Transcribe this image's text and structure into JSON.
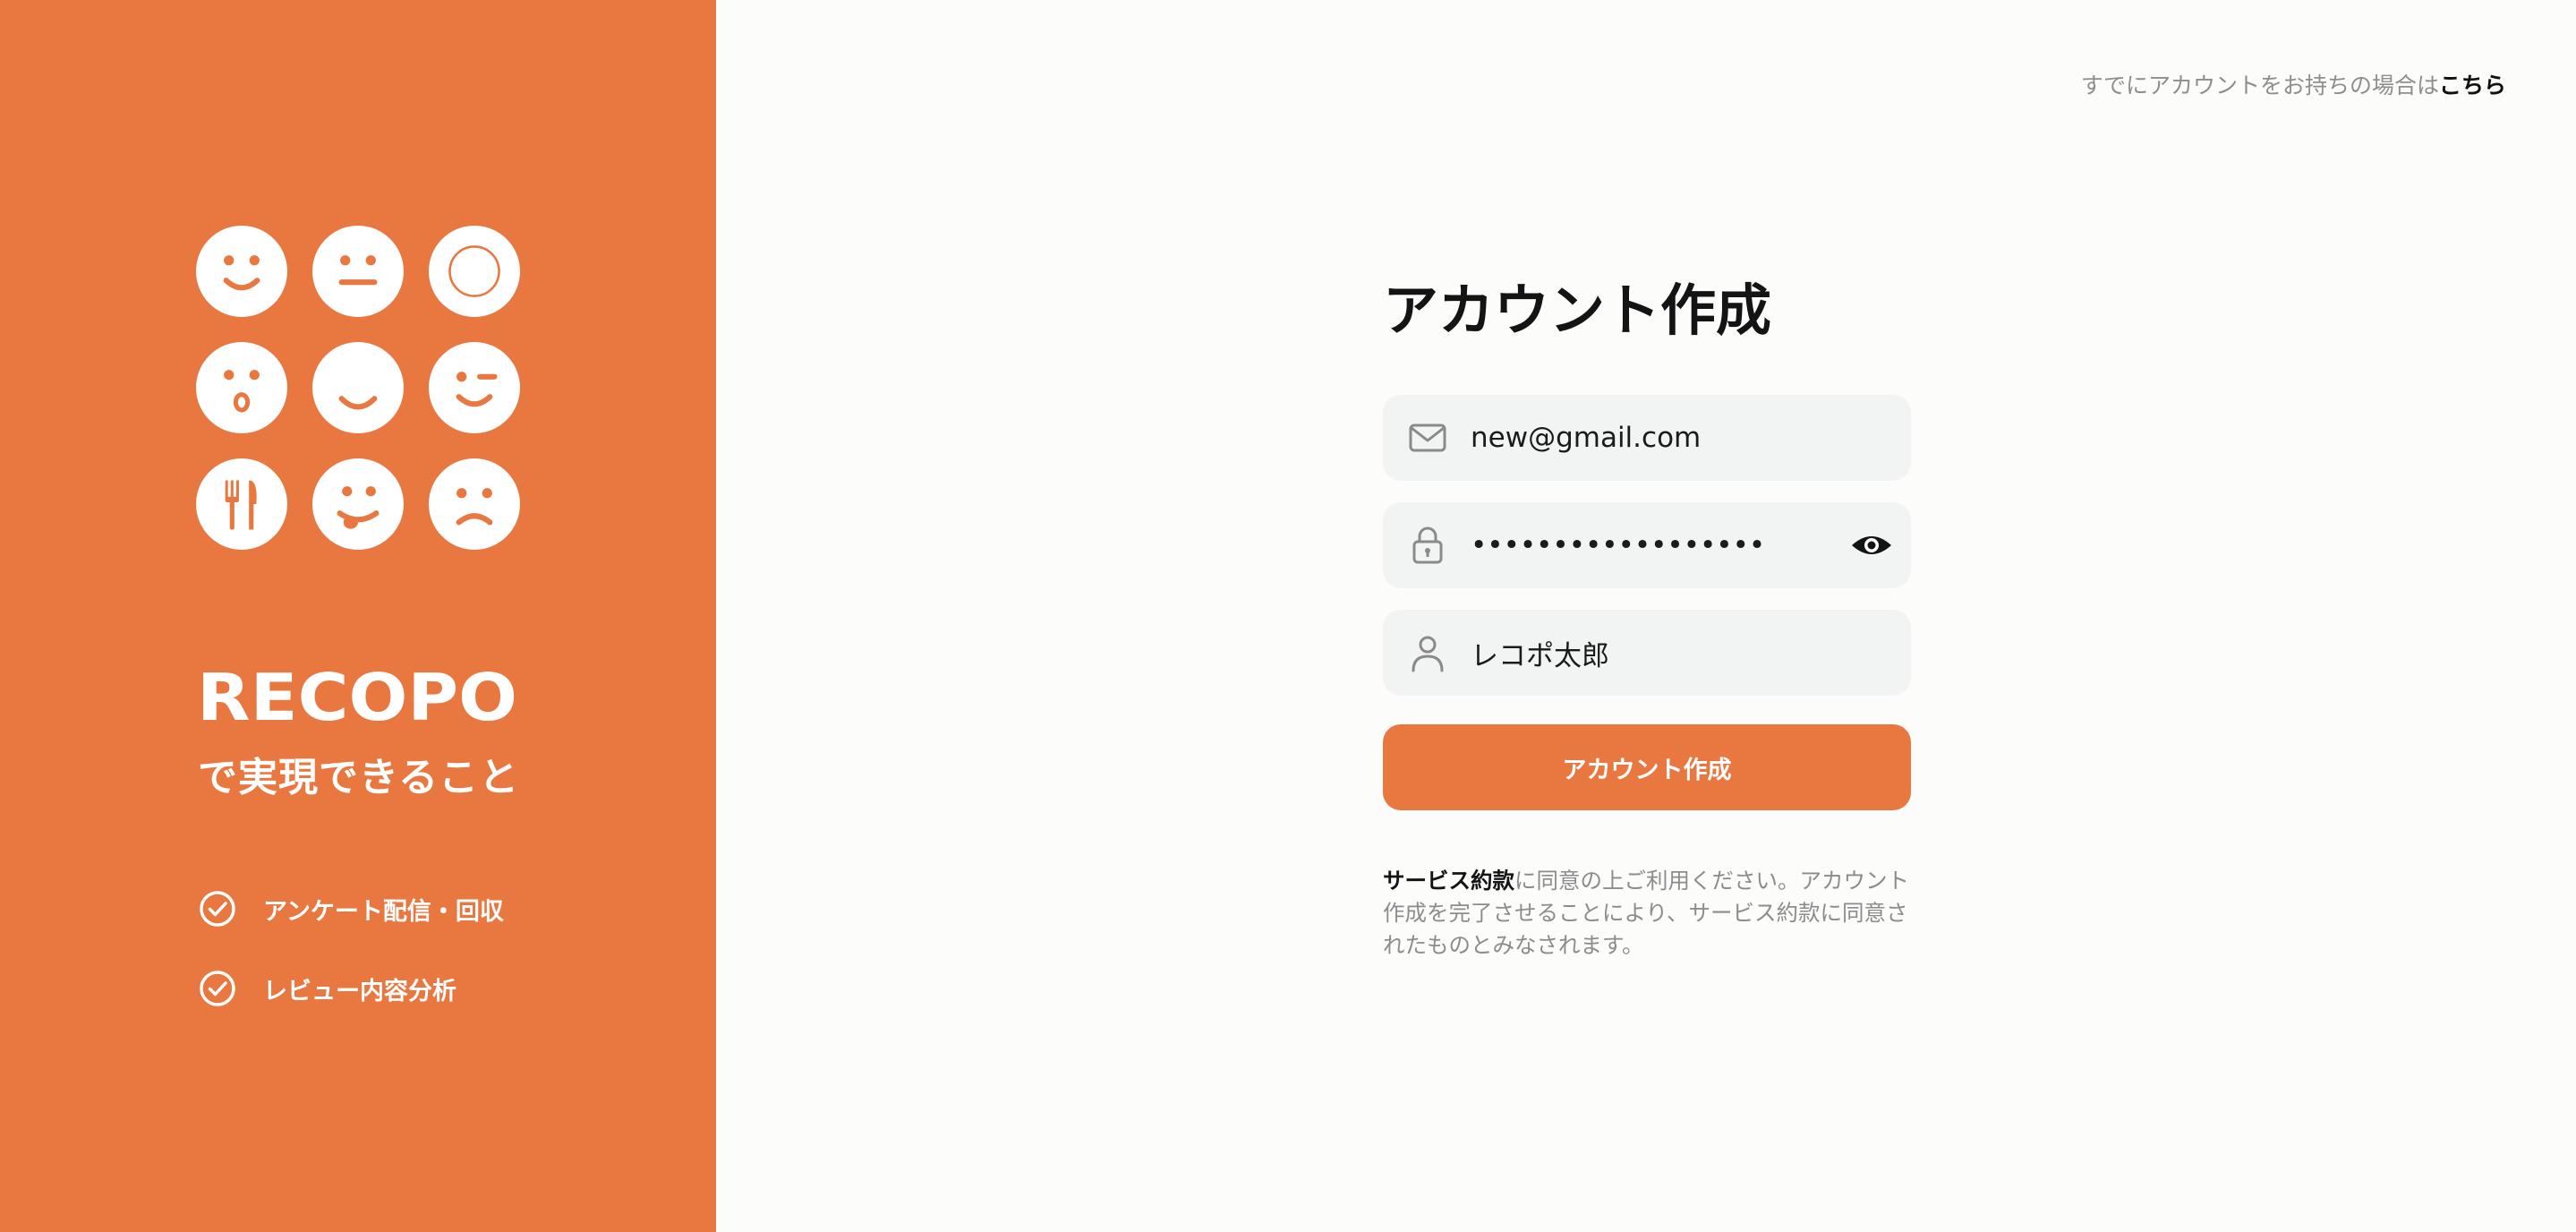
{
  "brand": {
    "logo_text": "RECOPO",
    "tagline": "で実現できること",
    "color": "#e97740",
    "faces": [
      "smile-face-icon",
      "neutral-face-icon",
      "circle-face-icon",
      "surprised-face-icon",
      "happy-face-icon",
      "wink-face-icon",
      "fork-knife-icon",
      "tongue-face-icon",
      "sad-face-icon"
    ]
  },
  "features": [
    {
      "icon": "check-circle-icon",
      "label": "アンケート配信・回収"
    },
    {
      "icon": "check-circle-icon",
      "label": "レビュー内容分析"
    }
  ],
  "header": {
    "login_prompt": "すでにアカウントをお持ちの場合は",
    "login_link": "こちら"
  },
  "form": {
    "title": "アカウント作成",
    "email": {
      "icon": "mail-icon",
      "value": "new@gmail.com"
    },
    "password": {
      "icon": "lock-icon",
      "masked": "••••••••••••••••••",
      "toggle_icon": "eye-icon"
    },
    "name": {
      "icon": "user-icon",
      "value": "レコポ太郎"
    },
    "submit_label": "アカウント作成"
  },
  "terms": {
    "link": "サービス約款",
    "text": "に同意の上ご利用ください。アカウント作成を完了させることにより、サービス約款に同意されたものとみなされます。"
  }
}
